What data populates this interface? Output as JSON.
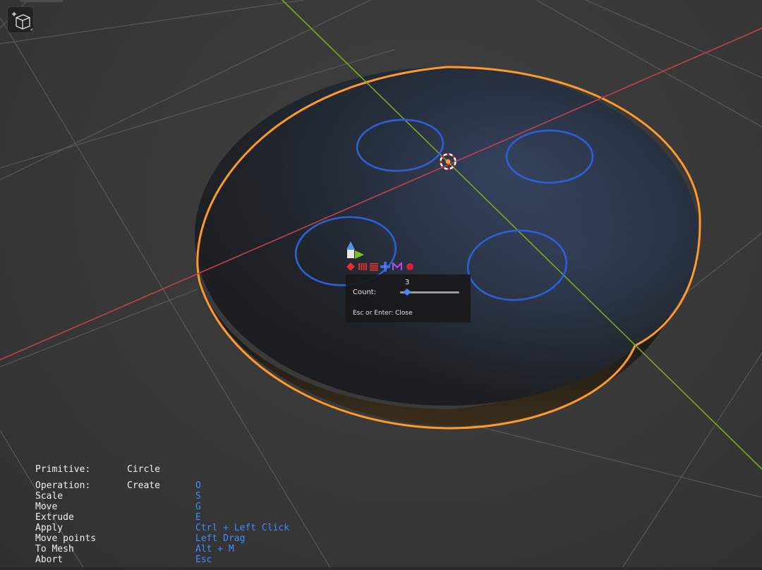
{
  "colors": {
    "background": "#3a3a3a",
    "grid_line": "#5a5a5a",
    "x_axis": "#c2404e",
    "y_axis": "#7ba81e",
    "selection_outline": "#ff9a2a",
    "disk_top": "#1e2328",
    "disk_highlight": "#2f3f5c",
    "cut_circle": "#2d5fd6",
    "shortcut_text": "#3d8bff"
  },
  "icons": {
    "view_gizmo": "add-cube-icon",
    "move_gizmo": "transform-gizmo-icon",
    "cursor": "3d-cursor-icon",
    "tools": [
      "vertex-diamond-icon",
      "vertical-bars-icon",
      "horizontal-bars-icon",
      "blue-cross-icon",
      "magenta-m-icon",
      "red-dot-icon"
    ]
  },
  "count_panel": {
    "label": "Count:",
    "value": "3",
    "slider_fraction": 0.12,
    "hint": "Esc or Enter: Close"
  },
  "info": {
    "primitive_label": "Primitive:",
    "primitive_value": "Circle",
    "rows": [
      {
        "action": "Operation:",
        "value": "Create",
        "key": "O"
      },
      {
        "action": "Scale",
        "value": "",
        "key": "S"
      },
      {
        "action": "Move",
        "value": "",
        "key": "G"
      },
      {
        "action": "Extrude",
        "value": "",
        "key": "E"
      },
      {
        "action": "Apply",
        "value": "",
        "key": "Ctrl + Left Click"
      },
      {
        "action": "Move points",
        "value": "",
        "key": "Left Drag"
      },
      {
        "action": "To Mesh",
        "value": "",
        "key": "Alt + M"
      },
      {
        "action": "Abort",
        "value": "",
        "key": "Esc"
      }
    ]
  }
}
